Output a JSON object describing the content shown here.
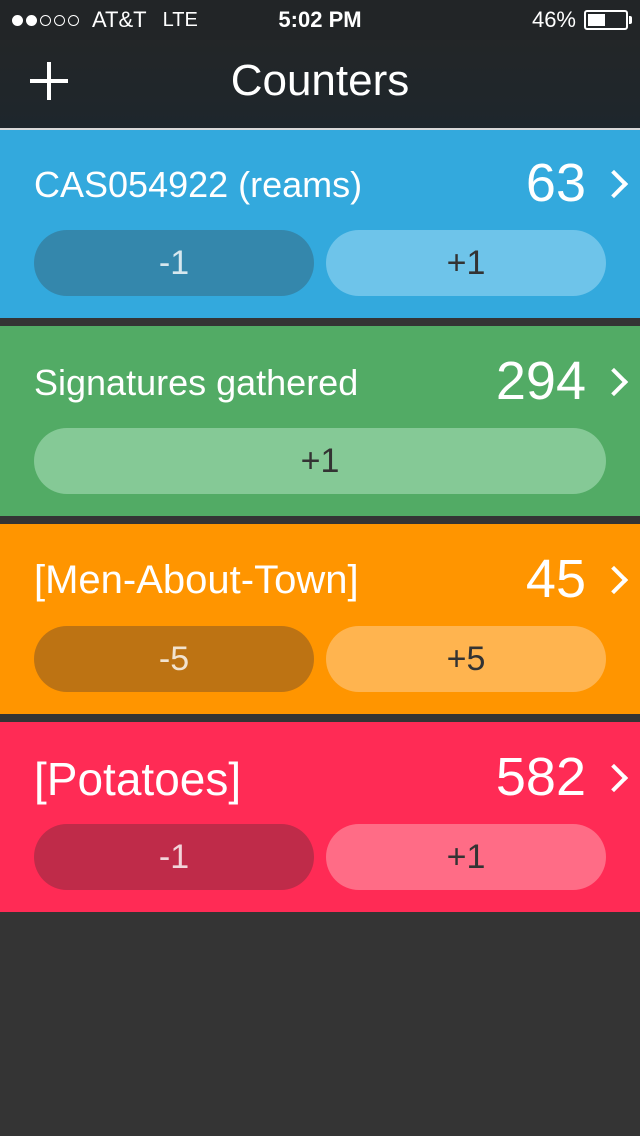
{
  "status_bar": {
    "carrier": "AT&T",
    "network": "LTE",
    "time": "5:02 PM",
    "battery": "46%",
    "battery_level": 0.46,
    "signal_bars": 2,
    "signal_max": 5
  },
  "nav": {
    "title": "Counters",
    "add_icon": "plus-icon"
  },
  "counters": [
    {
      "name": "CAS054922 (reams)",
      "count": "63",
      "color": "#33a9dd",
      "dec_color": "#3487ac",
      "inc_color": "#6ec4ea",
      "dec_label": "-1",
      "inc_label": "+1"
    },
    {
      "name": "Signatures gathered",
      "count": "294",
      "color": "#52ab65",
      "inc_color": "#85c996",
      "inc_label": "+1"
    },
    {
      "name": "[Men-About-Town]",
      "count": "45",
      "color": "#ff9500",
      "dec_color": "#bd7313",
      "inc_color": "#ffb44f",
      "dec_label": "-5",
      "inc_label": "+5"
    },
    {
      "name": "[Potatoes]",
      "count": "582",
      "color": "#ff2b55",
      "dec_color": "#bf2b49",
      "inc_color": "#ff6c86",
      "dec_label": "-1",
      "inc_label": "+1"
    }
  ]
}
